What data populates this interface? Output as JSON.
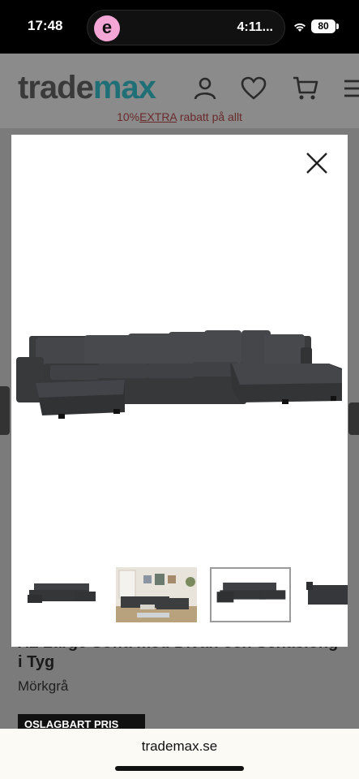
{
  "status_bar": {
    "time": "17:48",
    "app_letter": "e",
    "timer": "4:11...",
    "battery": "80"
  },
  "header": {
    "logo_part1": "trade",
    "logo_part2": "max"
  },
  "promo": {
    "text_before": "10%",
    "link": "EXTRA",
    "text_after": " rabatt på allt"
  },
  "product": {
    "title": "XL Large Soffa med Divan och Schäslong i Tyg",
    "variant": "Mörkgrå",
    "price_badge": "OSLAGBART PRIS"
  },
  "gallery": {
    "active_thumbnail": 3,
    "thumbnail_count": 4
  },
  "browser": {
    "url": "trademax.se"
  },
  "colors": {
    "brand_teal": "#1f6f77",
    "sofa": "#3c3d3f",
    "overlay": "#7b7b7b"
  }
}
